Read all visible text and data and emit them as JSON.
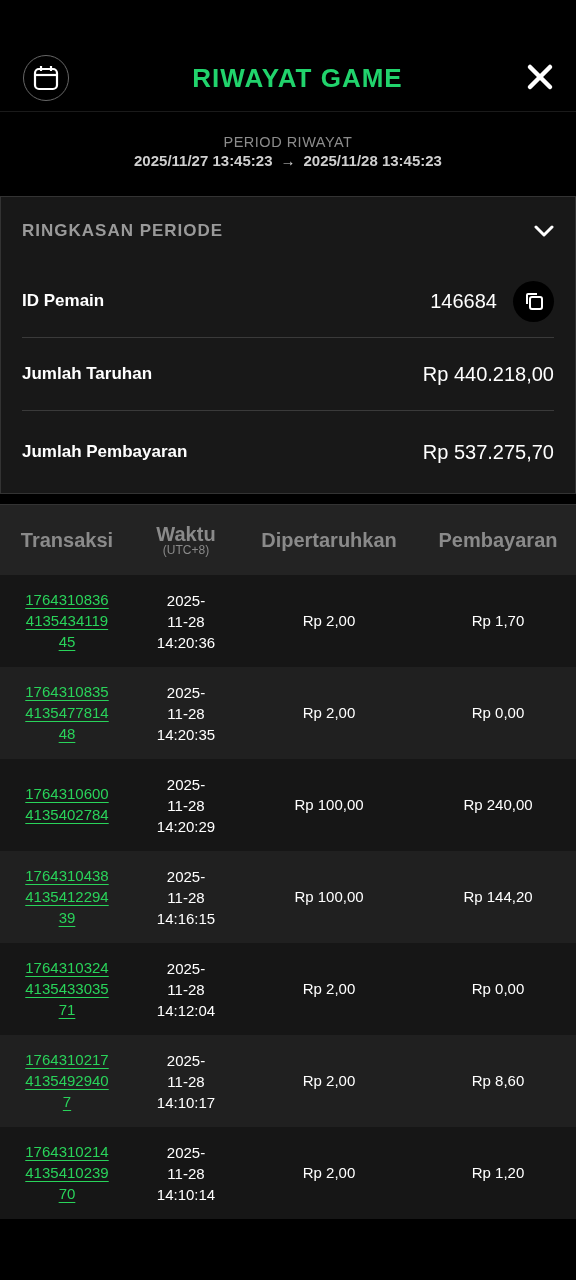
{
  "header": {
    "title": "RIWAYAT GAME"
  },
  "period": {
    "label": "PERIOD RIWAYAT",
    "start": "2025/11/27 13:45:23",
    "arrow": "→",
    "end": "2025/11/28 13:45:23"
  },
  "summary": {
    "title": "RINGKASAN PERIODE",
    "expanded": true,
    "rows": [
      {
        "kind": "copy",
        "label": "ID Pemain",
        "value": "146684"
      },
      {
        "kind": "plain",
        "label": "Jumlah Taruhan",
        "value": "Rp 440.218,00"
      },
      {
        "kind": "plain",
        "label": "Jumlah Pembayaran",
        "value": "Rp 537.275,70"
      }
    ]
  },
  "table": {
    "columns": [
      {
        "label": "Transaksi"
      },
      {
        "label": "Waktu",
        "sub": "(UTC+8)"
      },
      {
        "label": "Dipertaruhkan"
      },
      {
        "label": "Pembayaran"
      }
    ],
    "rows": [
      {
        "transaction": "1764310836413543411945",
        "date": "2025-11-28",
        "time": "14:20:36",
        "stake": "Rp 2,00",
        "payout": "Rp 1,70"
      },
      {
        "transaction": "1764310835413547781448",
        "date": "2025-11-28",
        "time": "14:20:35",
        "stake": "Rp 2,00",
        "payout": "Rp 0,00"
      },
      {
        "transaction": "17643106004135402784",
        "date": "2025-11-28",
        "time": "14:20:29",
        "stake": "Rp 100,00",
        "payout": "Rp 240,00"
      },
      {
        "transaction": "1764310438413541229439",
        "date": "2025-11-28",
        "time": "14:16:15",
        "stake": "Rp 100,00",
        "payout": "Rp 144,20"
      },
      {
        "transaction": "1764310324413543303571",
        "date": "2025-11-28",
        "time": "14:12:04",
        "stake": "Rp 2,00",
        "payout": "Rp 0,00"
      },
      {
        "transaction": "176431021741354929407",
        "date": "2025-11-28",
        "time": "14:10:17",
        "stake": "Rp 2,00",
        "payout": "Rp 8,60"
      },
      {
        "transaction": "1764310214413541023970",
        "date": "2025-11-28",
        "time": "14:10:14",
        "stake": "Rp 2,00",
        "payout": "Rp 1,20"
      }
    ]
  }
}
